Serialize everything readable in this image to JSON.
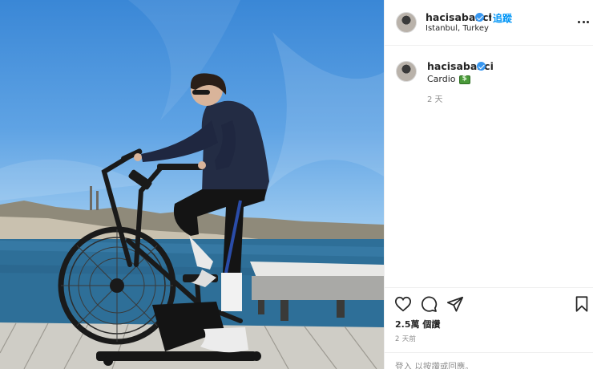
{
  "post": {
    "username": "hacisabanci",
    "follow_label": "追蹤",
    "separator": "•",
    "location": "Istanbul, Turkey",
    "caption_text": "Cardio",
    "caption_emoji": "money-with-wings-emoji",
    "caption_time": "2 天",
    "likes": "2.5萬 個讚",
    "post_time": "2 天前",
    "login_prompt": "登入 以按讚或回應。"
  },
  "icons": {
    "verified": "verified-badge-icon",
    "more": "more-options-icon",
    "like": "heart-icon",
    "comment": "comment-icon",
    "share": "paper-plane-icon",
    "save": "bookmark-icon"
  },
  "colors": {
    "accent": "#0095f6",
    "verified": "#3897f0",
    "muted": "#8e8e8e"
  }
}
